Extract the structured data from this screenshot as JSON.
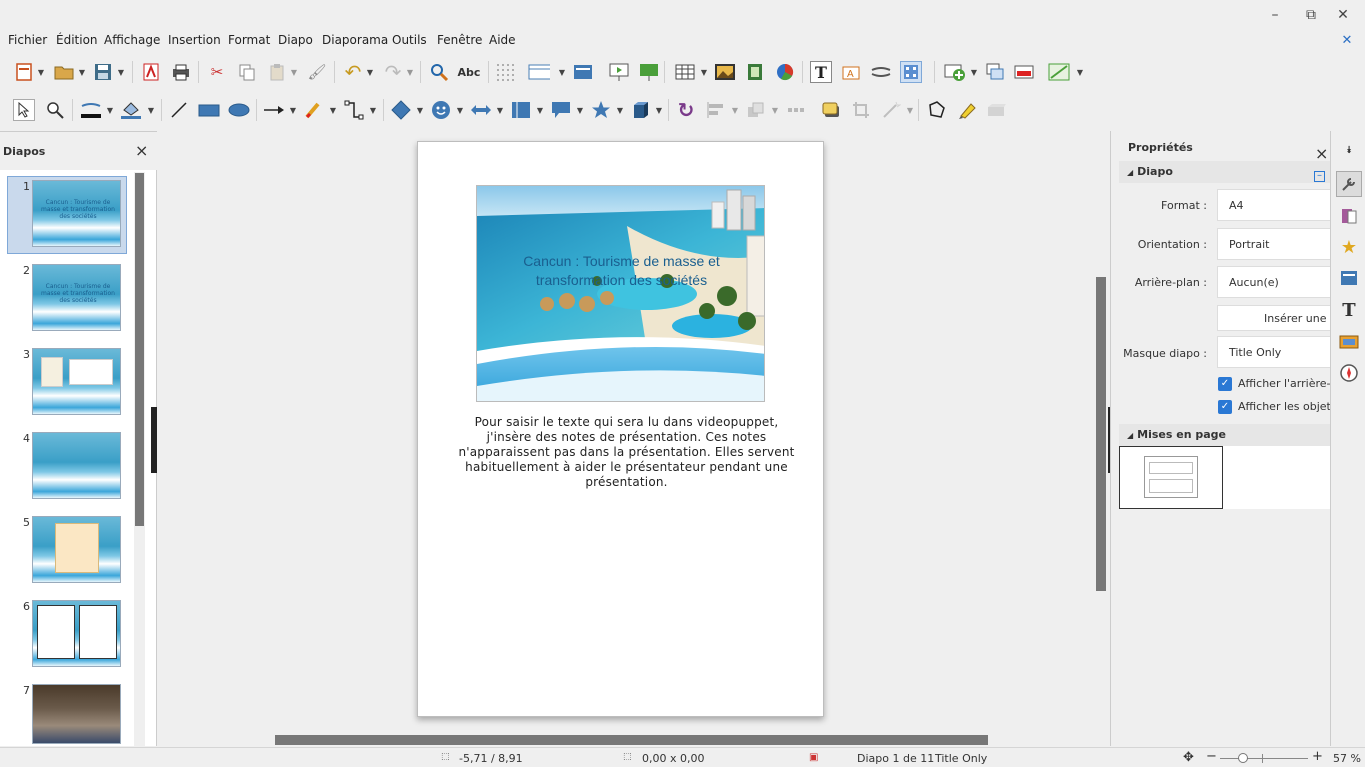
{
  "window": {
    "minimize": "–",
    "restore": "⧉",
    "close": "✕"
  },
  "menu": [
    "Fichier",
    "Édition",
    "Affichage",
    "Insertion",
    "Format",
    "Diapo",
    "Diaporama",
    "Outils",
    "Fenêtre",
    "Aide"
  ],
  "slides_panel": {
    "title": "Diapos",
    "close": "×",
    "slides": [
      {
        "num": "1",
        "caption": "Cancun : Tourisme de masse et transformation des sociétés"
      },
      {
        "num": "2",
        "caption": "Cancun : Tourisme de masse et transformation des sociétés"
      },
      {
        "num": "3",
        "caption": ""
      },
      {
        "num": "4",
        "caption": ""
      },
      {
        "num": "5",
        "caption": ""
      },
      {
        "num": "6",
        "caption": ""
      },
      {
        "num": "7",
        "caption": ""
      }
    ]
  },
  "slide": {
    "title": "Cancun : Tourisme de masse et transformation des sociétés"
  },
  "notes": "Pour saisir le texte qui sera lu dans videopuppet, j'insère des notes de présentation. Ces notes n'apparaissent pas dans la présentation. Elles servent habituellement à aider le présentateur pendant une présentation.",
  "sidebar": {
    "title": "Propriétés",
    "close": "×",
    "section_diapo": "Diapo",
    "format_label": "Format :",
    "format_value": "A4",
    "orientation_label": "Orientation :",
    "orientation_value": "Portrait",
    "background_label": "Arrière-plan :",
    "background_value": "Aucun(e)",
    "insert_image": "Insérer une im",
    "master_label": "Masque diapo :",
    "master_value": "Title Only",
    "show_background": "Afficher l'arrière-pl",
    "show_objects": "Afficher les objets",
    "section_layouts": "Mises en page"
  },
  "status": {
    "position": "-5,71 / 8,91",
    "size": "0,00 x 0,00",
    "slide_info": "Diapo 1 de 11",
    "master": "Title Only",
    "zoom": "57 %",
    "zoom_minus": "−",
    "zoom_plus": "+"
  },
  "colors": {
    "accent_blue": "#2a78d4",
    "sea": "#3aa6da",
    "title_text": "#1a5f8f"
  }
}
